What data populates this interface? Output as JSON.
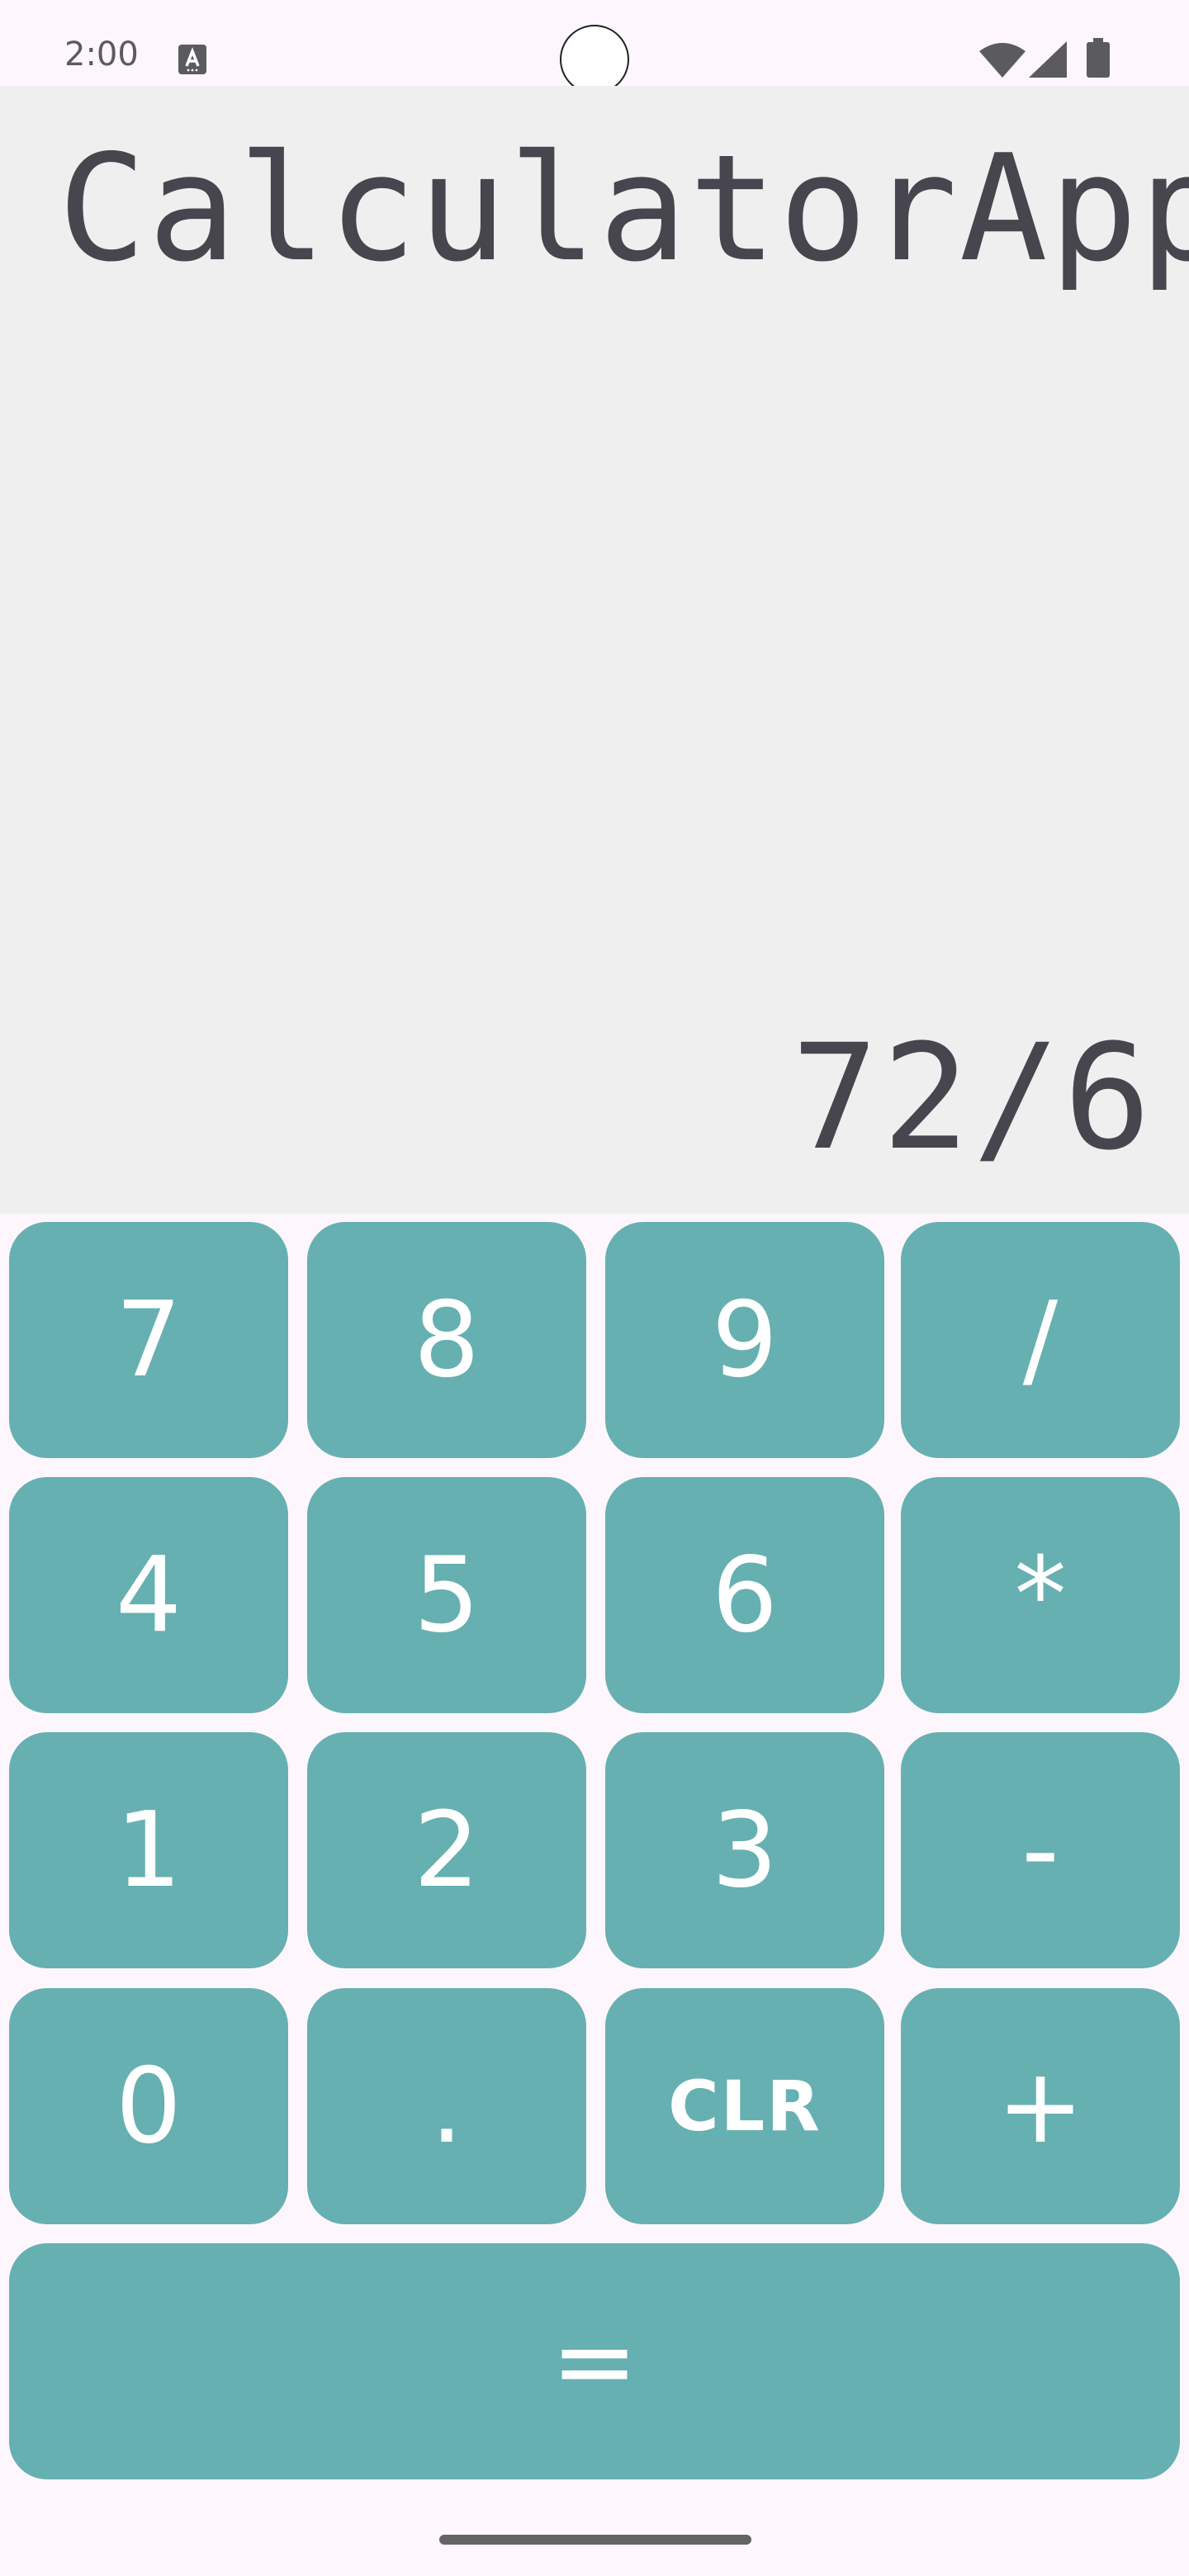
{
  "status_bar": {
    "time": "2:00",
    "icons": [
      "accessibility-a-icon",
      "wifi-icon",
      "signal-icon",
      "battery-icon"
    ]
  },
  "display": {
    "title": "CalculatorApp",
    "expression": "72/6"
  },
  "keypad": {
    "rows": [
      [
        "7",
        "8",
        "9",
        "/"
      ],
      [
        "4",
        "5",
        "6",
        "*"
      ],
      [
        "1",
        "2",
        "3",
        "-"
      ],
      [
        "0",
        ".",
        "CLR",
        "+"
      ]
    ],
    "equals": "="
  },
  "colors": {
    "background": "#fdf6fc",
    "display_background": "#efefef",
    "key_background": "#66b0b1",
    "key_text": "#ffffff",
    "display_text": "#47454d"
  }
}
